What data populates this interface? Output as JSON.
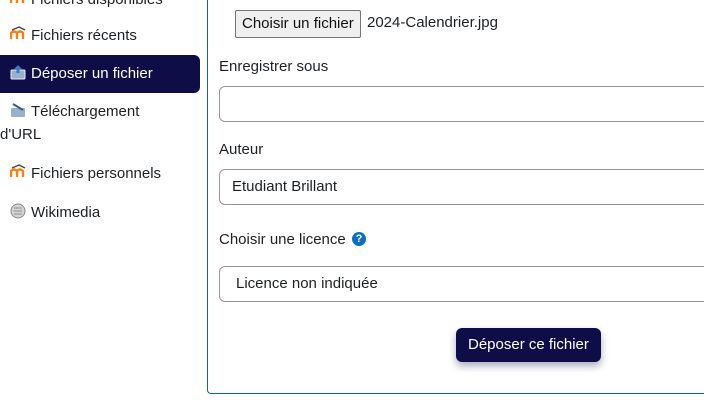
{
  "sidebar": {
    "items": [
      {
        "label": "Fichiers disponibles",
        "icon": "moodle-icon"
      },
      {
        "label": "Fichiers récents",
        "icon": "moodle-icon"
      },
      {
        "label": "Déposer un fichier",
        "icon": "upload-icon",
        "active": true
      },
      {
        "label_line1": "Téléchargement",
        "label_line2": "d'URL",
        "icon": "url-download-icon"
      },
      {
        "label": "Fichiers personnels",
        "icon": "moodle-icon"
      },
      {
        "label": "Wikimedia",
        "icon": "wikimedia-icon"
      }
    ]
  },
  "form": {
    "file_button_label": "Choisir un fichier",
    "file_name": "2024-Calendrier.jpg",
    "save_as_label": "Enregistrer sous",
    "save_as_value": "",
    "author_label": "Auteur",
    "author_value": "Etudiant Brillant",
    "license_label": "Choisir une licence",
    "license_value": "Licence non indiquée",
    "submit_label": "Déposer ce fichier"
  },
  "colors": {
    "accent": "#0f0d47",
    "help": "#0f6cbf",
    "moodle_orange": "#f98012"
  }
}
